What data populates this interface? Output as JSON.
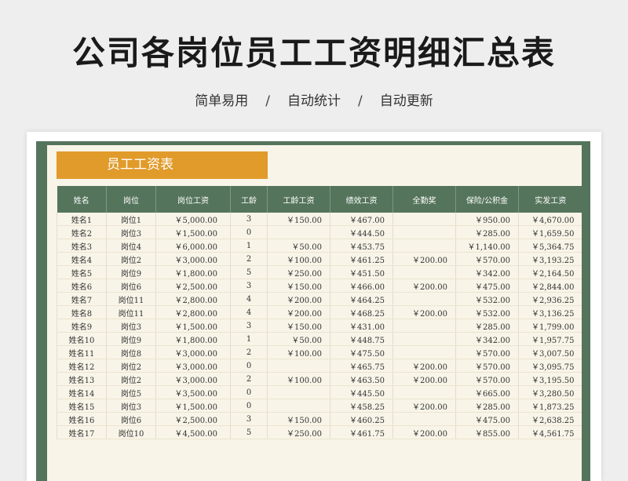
{
  "header": {
    "title": "公司各岗位员工工资明细汇总表",
    "features": [
      "简单易用",
      "自动统计",
      "自动更新"
    ],
    "separator": "/"
  },
  "sheet": {
    "title": "员工工资表",
    "columns": [
      "姓名",
      "岗位",
      "岗位工资",
      "工龄",
      "工龄工资",
      "绩效工资",
      "全勤奖",
      "保险/公积金",
      "实发工资"
    ],
    "rows": [
      [
        "姓名1",
        "岗位1",
        "￥5,000.00",
        "3",
        "￥150.00",
        "￥467.00",
        "",
        "￥950.00",
        "￥4,670.00"
      ],
      [
        "姓名2",
        "岗位3",
        "￥1,500.00",
        "0",
        "",
        "￥444.50",
        "",
        "￥285.00",
        "￥1,659.50"
      ],
      [
        "姓名3",
        "岗位4",
        "￥6,000.00",
        "1",
        "￥50.00",
        "￥453.75",
        "",
        "￥1,140.00",
        "￥5,364.75"
      ],
      [
        "姓名4",
        "岗位2",
        "￥3,000.00",
        "2",
        "￥100.00",
        "￥461.25",
        "￥200.00",
        "￥570.00",
        "￥3,193.25"
      ],
      [
        "姓名5",
        "岗位9",
        "￥1,800.00",
        "5",
        "￥250.00",
        "￥451.50",
        "",
        "￥342.00",
        "￥2,164.50"
      ],
      [
        "姓名6",
        "岗位6",
        "￥2,500.00",
        "3",
        "￥150.00",
        "￥466.00",
        "￥200.00",
        "￥475.00",
        "￥2,844.00"
      ],
      [
        "姓名7",
        "岗位11",
        "￥2,800.00",
        "4",
        "￥200.00",
        "￥464.25",
        "",
        "￥532.00",
        "￥2,936.25"
      ],
      [
        "姓名8",
        "岗位11",
        "￥2,800.00",
        "4",
        "￥200.00",
        "￥468.25",
        "￥200.00",
        "￥532.00",
        "￥3,136.25"
      ],
      [
        "姓名9",
        "岗位3",
        "￥1,500.00",
        "3",
        "￥150.00",
        "￥431.00",
        "",
        "￥285.00",
        "￥1,799.00"
      ],
      [
        "姓名10",
        "岗位9",
        "￥1,800.00",
        "1",
        "￥50.00",
        "￥448.75",
        "",
        "￥342.00",
        "￥1,957.75"
      ],
      [
        "姓名11",
        "岗位8",
        "￥3,000.00",
        "2",
        "￥100.00",
        "￥475.50",
        "",
        "￥570.00",
        "￥3,007.50"
      ],
      [
        "姓名12",
        "岗位2",
        "￥3,000.00",
        "0",
        "",
        "￥465.75",
        "￥200.00",
        "￥570.00",
        "￥3,095.75"
      ],
      [
        "姓名13",
        "岗位2",
        "￥3,000.00",
        "2",
        "￥100.00",
        "￥463.50",
        "￥200.00",
        "￥570.00",
        "￥3,195.50"
      ],
      [
        "姓名14",
        "岗位5",
        "￥3,500.00",
        "0",
        "",
        "￥445.50",
        "",
        "￥665.00",
        "￥3,280.50"
      ],
      [
        "姓名15",
        "岗位3",
        "￥1,500.00",
        "0",
        "",
        "￥458.25",
        "￥200.00",
        "￥285.00",
        "￥1,873.25"
      ],
      [
        "姓名16",
        "岗位6",
        "￥2,500.00",
        "3",
        "￥150.00",
        "￥460.25",
        "",
        "￥475.00",
        "￥2,638.25"
      ],
      [
        "姓名17",
        "岗位10",
        "￥4,500.00",
        "5",
        "￥250.00",
        "￥461.75",
        "￥200.00",
        "￥855.00",
        "￥4,561.75"
      ]
    ]
  }
}
